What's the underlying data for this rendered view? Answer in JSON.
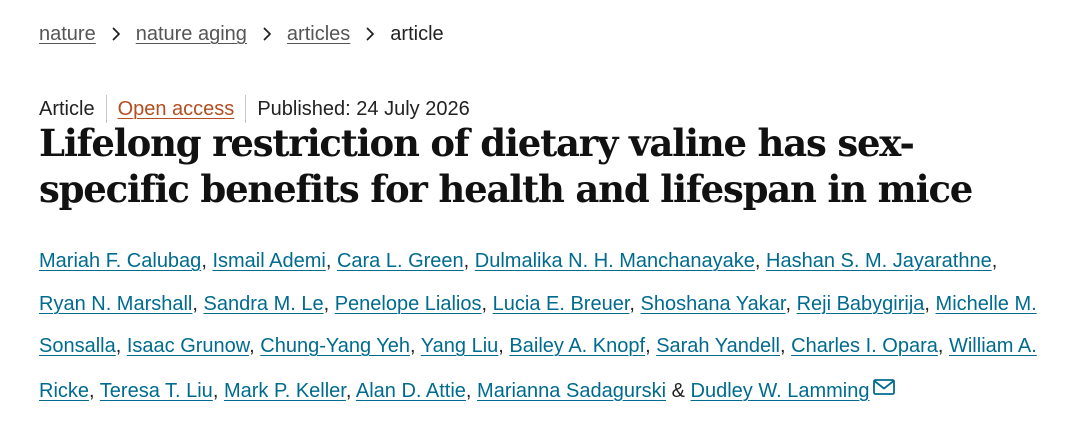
{
  "breadcrumb": {
    "items": [
      {
        "label": "nature"
      },
      {
        "label": "nature aging"
      },
      {
        "label": "articles"
      }
    ],
    "current": "article"
  },
  "meta": {
    "type": "Article",
    "access": "Open access",
    "published": "Published: 24 July 2026"
  },
  "title": "Lifelong restriction of dietary valine has sex-specific benefits for health and lifespan in mice",
  "authors": [
    "Mariah F. Calubag",
    "Ismail Ademi",
    "Cara L. Green",
    "Dulmalika N. H. Manchanayake",
    "Hashan S. M. Jayarathne",
    "Ryan N. Marshall",
    "Sandra M. Le",
    "Penelope Lialios",
    "Lucia E. Breuer",
    "Shoshana Yakar",
    "Reji Babygirija",
    "Michelle M. Sonsalla",
    "Isaac Grunow",
    "Chung-Yang Yeh",
    "Yang Liu",
    "Bailey A. Knopf",
    "Sarah Yandell",
    "Charles I. Opara",
    "William A. Ricke",
    "Teresa T. Liu",
    "Mark P. Keller",
    "Alan D. Attie",
    "Marianna Sadagurski",
    "Dudley W. Lamming"
  ],
  "separators": {
    "comma": ",",
    "ampersand": "&"
  },
  "icons": {
    "breadcrumb_separator": "chevron-right-icon",
    "corresponding_author": "envelope-icon"
  },
  "colors": {
    "author_link": "#006b8f",
    "open_access": "#b34e1f",
    "breadcrumb_link": "#555555",
    "title": "#111111"
  }
}
